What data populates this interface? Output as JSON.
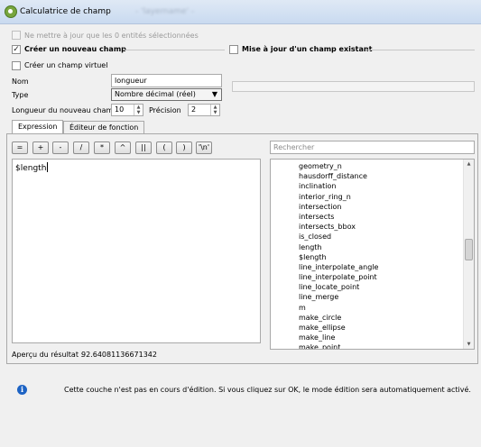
{
  "window": {
    "title": "Calculatrice de champ",
    "blurred_subtitle": "- 'layername' -"
  },
  "options": {
    "only_selected": {
      "label": "Ne mettre à jour que les 0 entités sélectionnées",
      "checked": false,
      "enabled": false
    },
    "create_new_field": {
      "label": "Créer un nouveau champ",
      "checked": true
    },
    "update_existing": {
      "label": "Mise à jour d'un champ existant",
      "checked": false
    },
    "virtual_field": {
      "label": "Créer un champ virtuel",
      "checked": false
    }
  },
  "field": {
    "name_label": "Nom",
    "name_value": "longueur",
    "type_label": "Type",
    "type_value": "Nombre décimal (réel)",
    "length_label": "Longueur du nouveau champ",
    "length_value": "10",
    "precision_label": "Précision",
    "precision_value": "2"
  },
  "tabs": [
    {
      "label": "Expression",
      "active": true
    },
    {
      "label": "Éditeur de fonction",
      "active": false
    }
  ],
  "operators": [
    "=",
    "+",
    "-",
    "/",
    "*",
    "^",
    "||",
    "(",
    ")",
    "'\\n'"
  ],
  "expression": {
    "text": "$length"
  },
  "search": {
    "placeholder": "Rechercher"
  },
  "functions": {
    "items": [
      "geometry_n",
      "hausdorff_distance",
      "inclination",
      "interior_ring_n",
      "intersection",
      "intersects",
      "intersects_bbox",
      "is_closed",
      "length",
      "$length",
      "line_interpolate_angle",
      "line_interpolate_point",
      "line_locate_point",
      "line_merge",
      "m",
      "make_circle",
      "make_ellipse",
      "make_line",
      "make_point"
    ],
    "scroll_position": 0.47
  },
  "preview": {
    "label": "Aperçu du résultat :",
    "value": "92.64081136671342"
  },
  "info": {
    "message": "Cette couche n'est pas en cours d'édition. Si vous cliquez sur OK, le mode édition sera automatiquement activé."
  }
}
